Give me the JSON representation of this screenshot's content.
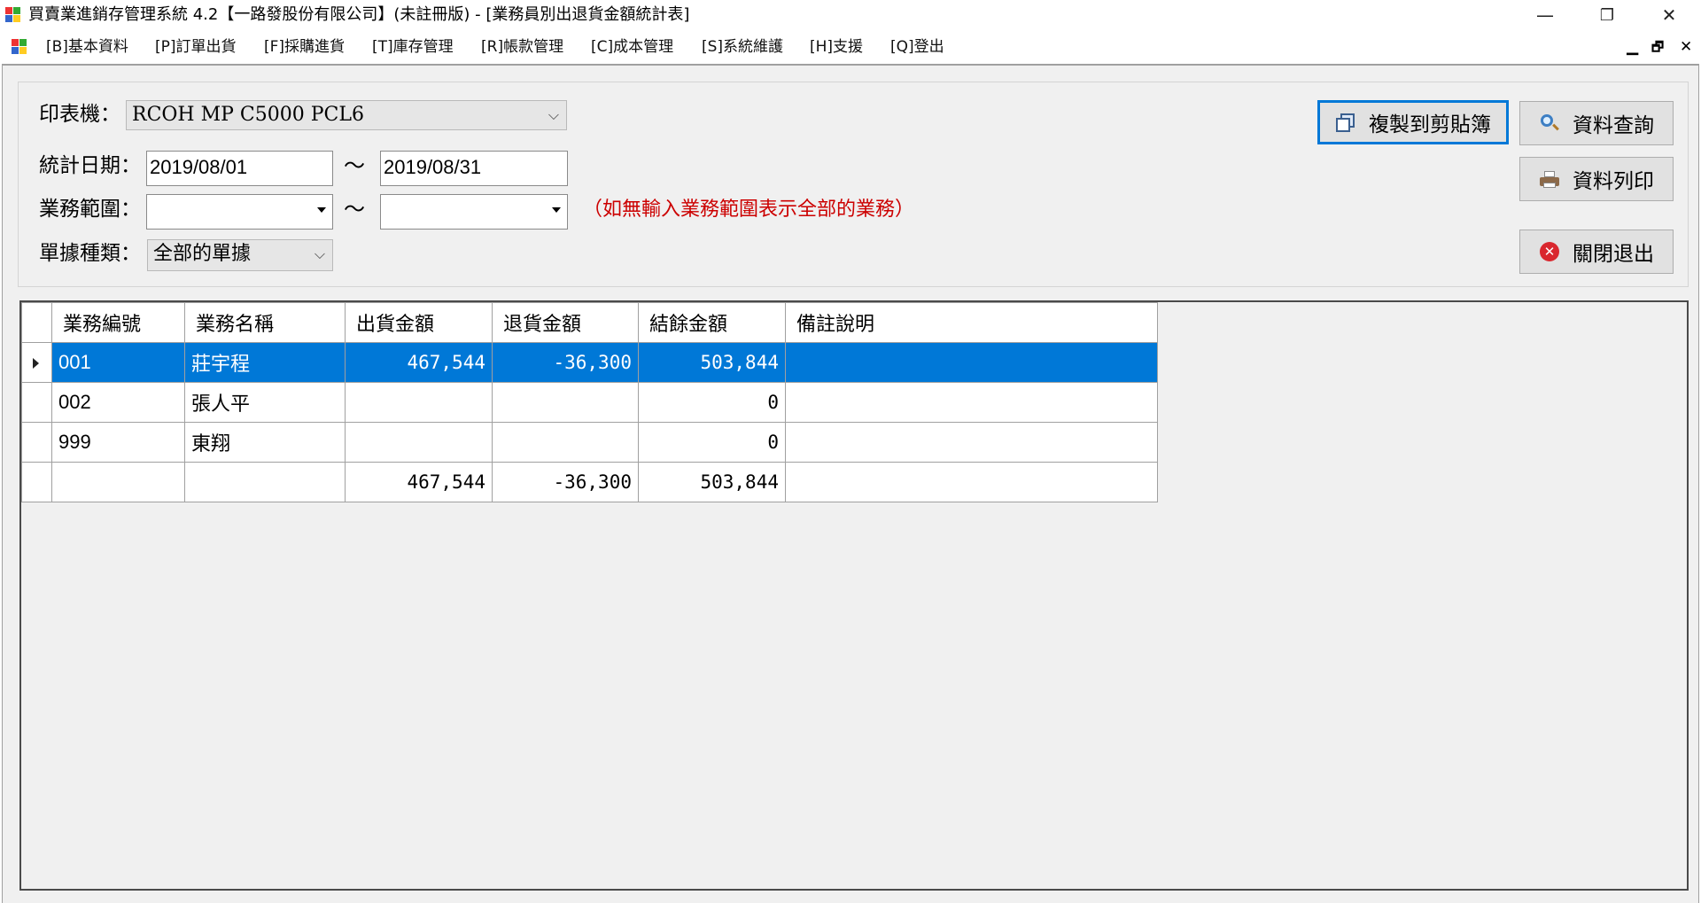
{
  "window": {
    "title": "買賣業進銷存管理系統 4.2【一路發股份有限公司】(未註冊版) - [業務員別出退貨金額統計表]",
    "minimize": "—",
    "restore": "❐",
    "close": "✕"
  },
  "menu": {
    "items": [
      "[B]基本資料",
      "[P]訂單出貨",
      "[F]採購進貨",
      "[T]庫存管理",
      "[R]帳款管理",
      "[C]成本管理",
      "[S]系統維護",
      "[H]支援",
      "[Q]登出"
    ],
    "mdi_min": "▁",
    "mdi_restore": "🗗",
    "mdi_close": "✕"
  },
  "form": {
    "printer_label": "印表機：",
    "printer_value": "RCOH MP C5000 PCL6",
    "date_label": "統計日期：",
    "date_from": "2019/08/01",
    "date_to": "2019/08/31",
    "tilde": "～",
    "range_label": "業務範圍：",
    "range_from": "",
    "range_to": "",
    "range_hint": "（如無輸入業務範圍表示全部的業務）",
    "doctype_label": "單據種類：",
    "doctype_value": "全部的單據"
  },
  "buttons": {
    "copy": "複製到剪貼簿",
    "query": "資料查詢",
    "print": "資料列印",
    "close": "關閉退出"
  },
  "grid": {
    "columns": [
      "業務編號",
      "業務名稱",
      "出貨金額",
      "退貨金額",
      "結餘金額",
      "備註說明"
    ],
    "rows": [
      {
        "id": "001",
        "name": "莊宇程",
        "ship": "467,544",
        "ret": "-36,300",
        "bal": "503,844",
        "note": ""
      },
      {
        "id": "002",
        "name": "張人平",
        "ship": "",
        "ret": "",
        "bal": "0",
        "note": ""
      },
      {
        "id": "999",
        "name": "東翔",
        "ship": "",
        "ret": "",
        "bal": "0",
        "note": ""
      }
    ],
    "total": {
      "ship": "467,544",
      "ret": "-36,300",
      "bal": "503,844"
    }
  }
}
